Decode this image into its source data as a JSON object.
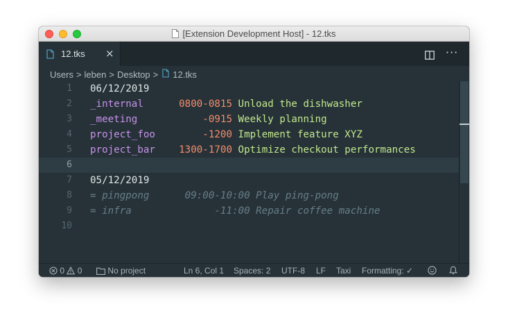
{
  "window": {
    "title": "[Extension Development Host] - 12.tks"
  },
  "tab": {
    "label": "12.tks",
    "close": "×"
  },
  "breadcrumb": [
    "Users",
    "leben",
    "Desktop",
    "12.tks"
  ],
  "breadcrumb_sep": ">",
  "editor": {
    "current_line": 6,
    "lines": [
      {
        "num": "1",
        "tokens": [
          {
            "cls": "c-date",
            "text": "06/12/2019"
          }
        ]
      },
      {
        "num": "2",
        "tokens": [
          {
            "cls": "c-project",
            "text": "_internal      "
          },
          {
            "cls": "c-time",
            "text": "0800-0815"
          },
          {
            "cls": "c-desc",
            "text": " Unload the dishwasher"
          }
        ]
      },
      {
        "num": "3",
        "tokens": [
          {
            "cls": "c-project",
            "text": "_meeting           "
          },
          {
            "cls": "c-time",
            "text": "-0915"
          },
          {
            "cls": "c-desc",
            "text": " Weekly planning"
          }
        ]
      },
      {
        "num": "4",
        "tokens": [
          {
            "cls": "c-project",
            "text": "project_foo        "
          },
          {
            "cls": "c-time",
            "text": "-1200"
          },
          {
            "cls": "c-desc",
            "text": " Implement feature XYZ"
          }
        ]
      },
      {
        "num": "5",
        "tokens": [
          {
            "cls": "c-project",
            "text": "project_bar    "
          },
          {
            "cls": "c-time",
            "text": "1300-1700"
          },
          {
            "cls": "c-desc",
            "text": " Optimize checkout performances"
          }
        ]
      },
      {
        "num": "6",
        "tokens": []
      },
      {
        "num": "7",
        "tokens": [
          {
            "cls": "c-date",
            "text": "05/12/2019"
          }
        ]
      },
      {
        "num": "8",
        "tokens": [
          {
            "cls": "c-comment",
            "text": "= pingpong      09:00-10:00 Play ping-pong"
          }
        ]
      },
      {
        "num": "9",
        "tokens": [
          {
            "cls": "c-comment",
            "text": "= infra              -11:00 Repair coffee machine"
          }
        ]
      },
      {
        "num": "10",
        "tokens": []
      }
    ]
  },
  "status": {
    "errors": "0",
    "warnings": "0",
    "folder": "No project",
    "position": "Ln 6, Col 1",
    "spaces": "Spaces: 2",
    "encoding": "UTF-8",
    "eol": "LF",
    "language": "Taxi",
    "formatting": "Formatting: ✓"
  },
  "icons": {
    "file": "file-icon",
    "split": "split-editor-icon",
    "more": "more-actions-icon",
    "error": "error-icon",
    "warning": "warning-icon",
    "folder": "folder-icon",
    "feedback": "smiley-icon",
    "bell": "bell-icon"
  },
  "colors": {
    "editor_bg": "#263238",
    "project": "#c792ea",
    "time": "#f78c6c",
    "description": "#c3e88d",
    "comment": "#687e88"
  }
}
